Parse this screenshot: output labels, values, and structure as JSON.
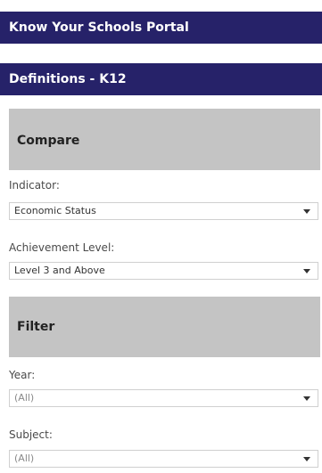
{
  "header": {
    "portal_title": "Know Your Schools Portal",
    "definitions_title": "Definitions - K12"
  },
  "compare": {
    "title": "Compare",
    "indicator": {
      "label": "Indicator:",
      "value": "Economic Status"
    },
    "achievement": {
      "label": "Achievement Level:",
      "value": "Level 3 and Above"
    }
  },
  "filter": {
    "title": "Filter",
    "year": {
      "label": "Year:",
      "value": "(All)"
    },
    "subject": {
      "label": "Subject:",
      "value": "(All)"
    }
  },
  "colors": {
    "banner": "#262269",
    "section": "#c4c4c4"
  },
  "icons": {
    "dropdown": "chevron-down-icon"
  }
}
